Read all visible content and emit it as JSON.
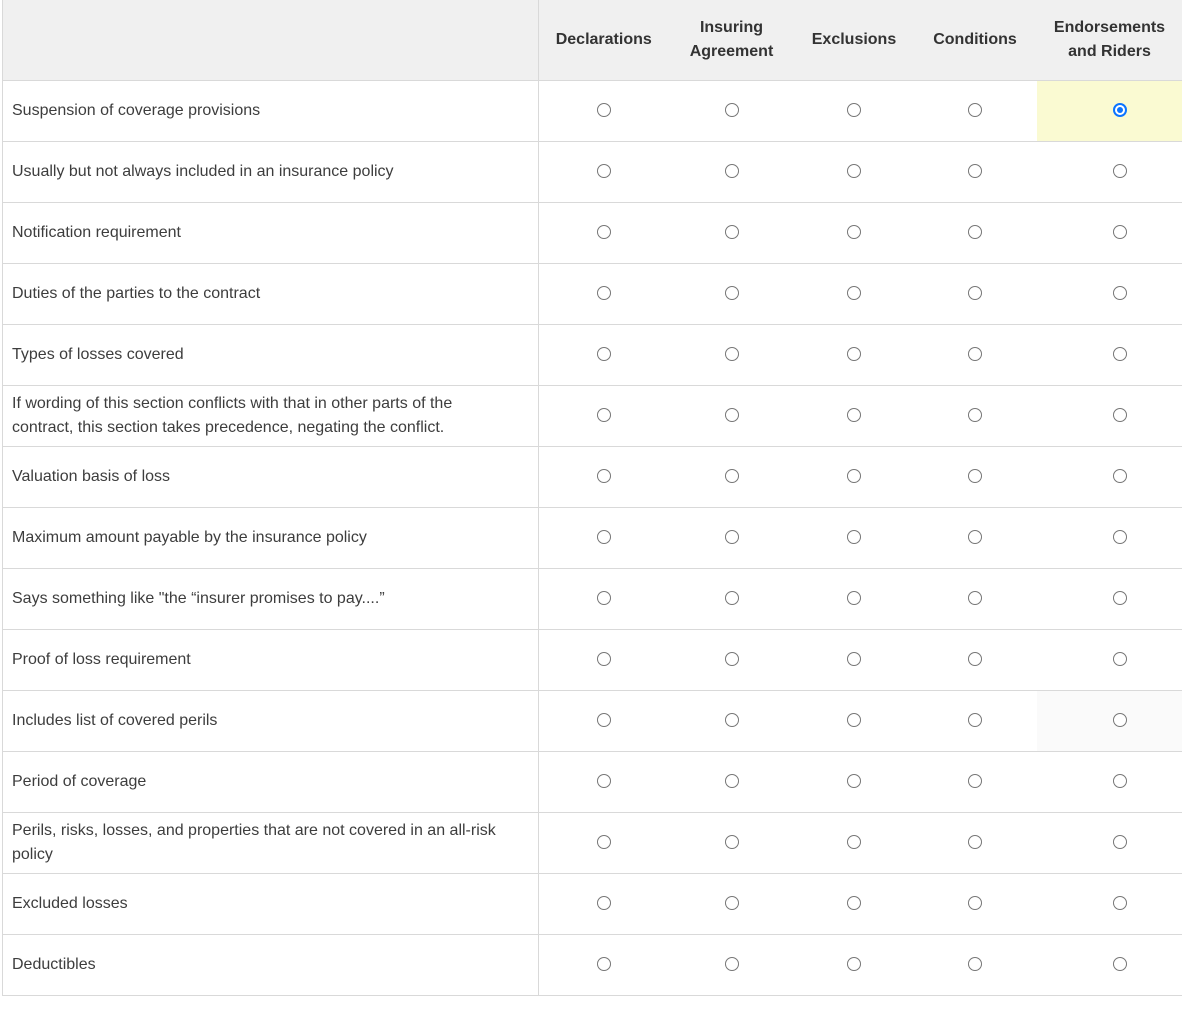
{
  "columns": [
    {
      "key": "declarations",
      "label": "Declarations"
    },
    {
      "key": "insuring_agreement",
      "label": "Insuring Agreement"
    },
    {
      "key": "exclusions",
      "label": "Exclusions"
    },
    {
      "key": "conditions",
      "label": "Conditions"
    },
    {
      "key": "endorsements_riders",
      "label": "Endorsements and Riders"
    }
  ],
  "rows": [
    {
      "label": "Suspension of coverage provisions",
      "selected": "endorsements_riders"
    },
    {
      "label": "Usually but not always included in an insurance policy",
      "selected": null
    },
    {
      "label": "Notification requirement",
      "selected": null
    },
    {
      "label": "Duties of the parties to the contract",
      "selected": null
    },
    {
      "label": "Types of losses covered",
      "selected": null
    },
    {
      "label": "If wording of this section conflicts with that in other parts of the contract, this section takes precedence, negating the conflict.",
      "selected": null
    },
    {
      "label": "Valuation basis of loss",
      "selected": null
    },
    {
      "label": "Maximum amount payable by the insurance policy",
      "selected": null
    },
    {
      "label": "Says something like \"the “insurer promises to pay....”",
      "selected": null
    },
    {
      "label": "Proof of loss requirement",
      "selected": null
    },
    {
      "label": "Includes list of covered perils",
      "selected": null,
      "hover": "endorsements_riders"
    },
    {
      "label": "Period of coverage",
      "selected": null
    },
    {
      "label": "Perils, risks, losses, and properties that are not covered in an all-risk policy",
      "selected": null
    },
    {
      "label": "Excluded losses",
      "selected": null
    },
    {
      "label": "Deductibles",
      "selected": null
    }
  ],
  "colors": {
    "header_bg": "#f0f0f0",
    "border": "#d9d9d9",
    "selected_cell_bg": "#fafad2",
    "radio_checked": "#0b74ff"
  }
}
